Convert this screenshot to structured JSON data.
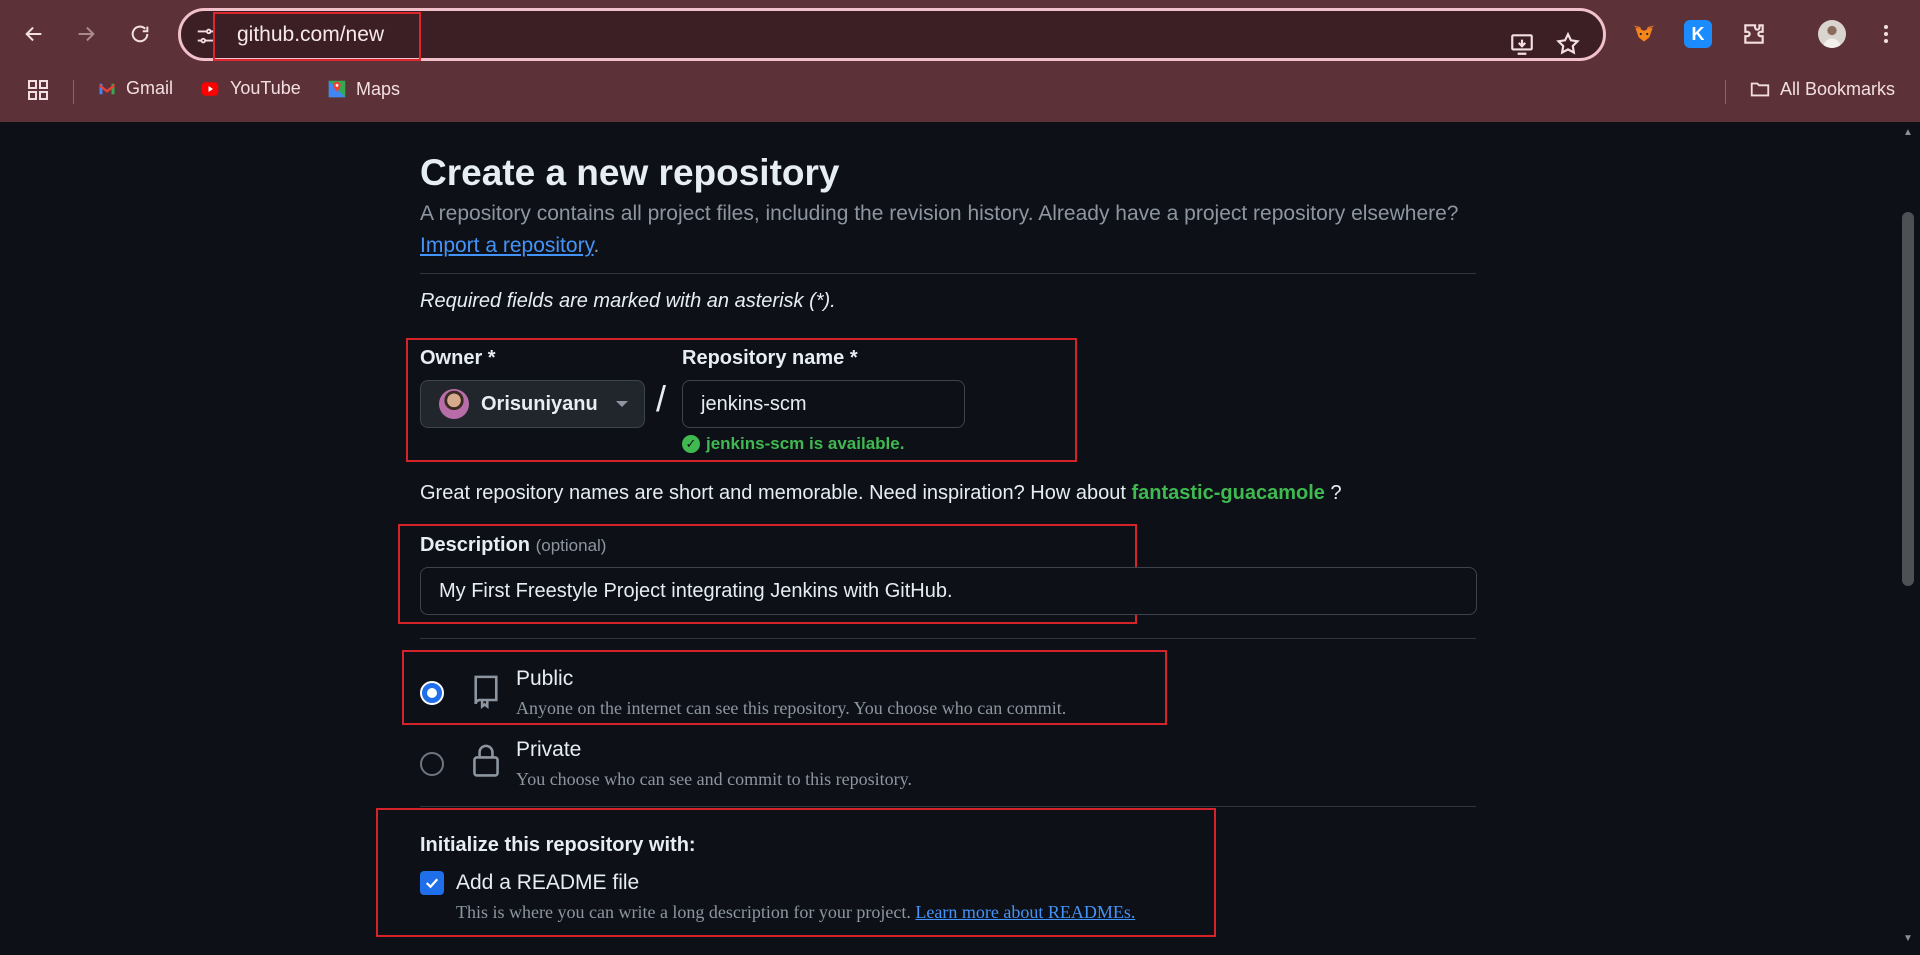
{
  "browser": {
    "url": "github.com/new",
    "bookmarks": {
      "gmail": "Gmail",
      "youtube": "YouTube",
      "maps": "Maps",
      "all": "All Bookmarks"
    },
    "extensions": {
      "k_letter": "K"
    }
  },
  "page": {
    "title": "Create a new repository",
    "subtitle": "A repository contains all project files, including the revision history. Already have a project repository elsewhere?",
    "import_link": "Import a repository",
    "import_suffix": ".",
    "required_note": "Required fields are marked with an asterisk (*).",
    "owner": {
      "label": "Owner *",
      "value": "Orisuniyanu"
    },
    "slash": "/",
    "repo_name": {
      "label": "Repository name *",
      "value": "jenkins-scm",
      "availability": "jenkins-scm is available."
    },
    "inspiration": {
      "prefix": "Great repository names are short and memorable. Need inspiration? How about",
      "suggestion": "fantastic-guacamole",
      "suffix": "?"
    },
    "description": {
      "label": "Description",
      "optional": "(optional)",
      "value": "My First Freestyle Project integrating Jenkins with GitHub."
    },
    "visibility": {
      "public": {
        "title": "Public",
        "desc": "Anyone on the internet can see this repository. You choose who can commit.",
        "selected": true
      },
      "private": {
        "title": "Private",
        "desc": "You choose who can see and commit to this repository.",
        "selected": false
      }
    },
    "init": {
      "title": "Initialize this repository with:",
      "readme_label": "Add a README file",
      "readme_checked": true,
      "readme_desc": "This is where you can write a long description for your project.",
      "readme_link": "Learn more about READMEs."
    }
  },
  "colors": {
    "chrome_bg": "#5c3238",
    "page_bg": "#0d1117",
    "accent_blue": "#1f6feb",
    "success_green": "#3fb950",
    "highlight_red": "#d4232b"
  }
}
